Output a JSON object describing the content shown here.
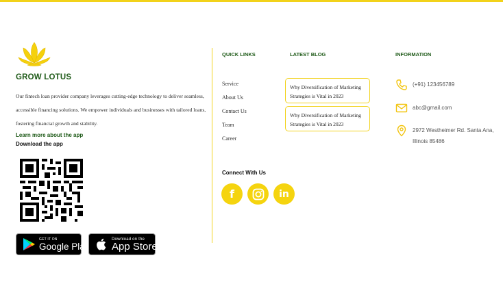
{
  "brand": {
    "name": "GROW LOTUS",
    "description": "Our fintech loan provider company leverages cutting-edge technology to deliver seamless, accessible financing solutions. We empower individuals and businesses with tailored loans, fostering financial growth and stability.",
    "learn_more": "Learn more about the app",
    "download_label": "Download the app",
    "logo_icon": "lotus-icon",
    "qr_icon": "qr-code-icon"
  },
  "stores": {
    "google": {
      "small": "GET IT ON",
      "big": "Google Play",
      "icon": "google-play-icon"
    },
    "apple": {
      "small": "Download on the",
      "big": "App Store",
      "icon": "apple-icon"
    }
  },
  "quick_links": {
    "heading": "QUICK LINKS",
    "items": [
      "Service",
      "About Us",
      "Contact Us",
      "Team",
      "Career"
    ]
  },
  "blog": {
    "heading": "LATEST BLOG",
    "posts": [
      "Why Diversification of Marketing Strategies is Vital in 2023",
      "Why Diversification of Marketing Strategies is Vital in 2023"
    ]
  },
  "connect": {
    "heading": "Connect With Us",
    "facebook": "f",
    "linkedin": "in"
  },
  "information": {
    "heading": "INFORMATION",
    "phone": "(+91) 123456789",
    "email": "abc@gmail.com",
    "address": "2972 Westheimer Rd. Santa Ana, Illinois 85486"
  },
  "colors": {
    "accent": "#f2d21a",
    "brand_green": "#1e5a18",
    "social_bg": "#f5d40f"
  }
}
